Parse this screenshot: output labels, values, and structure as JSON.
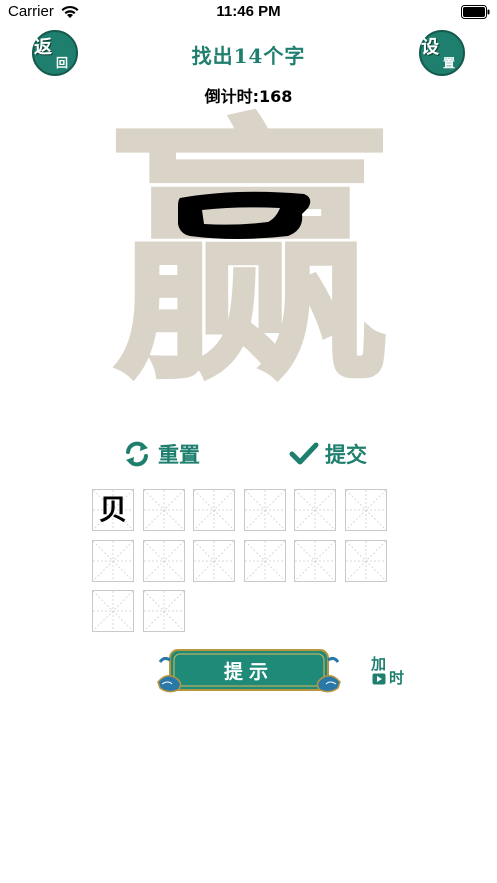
{
  "status_bar": {
    "carrier": "Carrier",
    "time": "11:46 PM"
  },
  "header": {
    "back_button": {
      "main": "返",
      "sub": "回"
    },
    "settings_button": {
      "main": "设",
      "sub": "置"
    },
    "title": "找出14个字",
    "countdown": "倒计时:168"
  },
  "puzzle": {
    "character": "赢"
  },
  "actions": {
    "reset_label": "重置",
    "submit_label": "提交"
  },
  "answer_grid": {
    "cells": [
      "贝",
      "",
      "",
      "",
      "",
      "",
      "",
      "",
      "",
      "",
      "",
      "",
      "",
      ""
    ]
  },
  "bottom": {
    "hint_label": "提示",
    "add_time": {
      "main": "加",
      "sub": "时"
    }
  },
  "colors": {
    "accent": "#1f7f6e",
    "faded_char": "#d9d3c8",
    "cell_border": "#c9c9c9"
  }
}
